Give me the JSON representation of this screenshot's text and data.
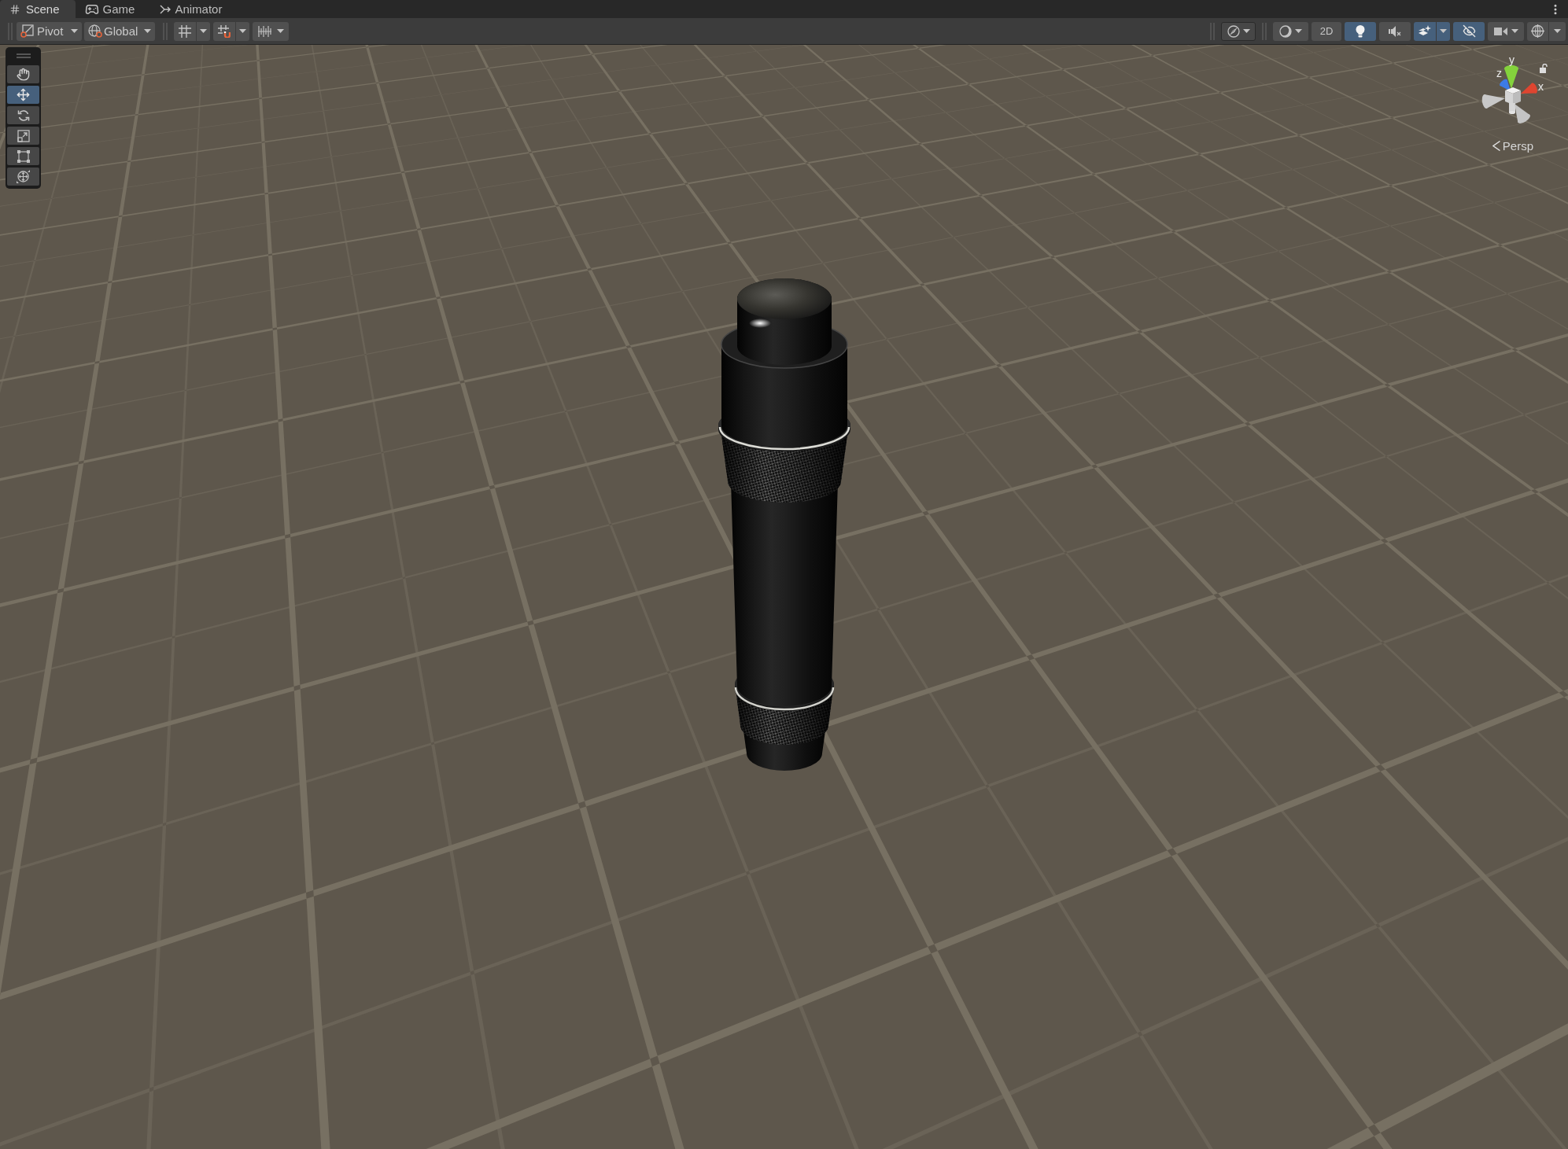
{
  "tabs": [
    {
      "label": "Scene",
      "selected": true
    },
    {
      "label": "Game",
      "selected": false
    },
    {
      "label": "Animator",
      "selected": false
    }
  ],
  "toolbar": {
    "pivot_dropdown": {
      "label": "Pivot"
    },
    "global_dropdown": {
      "label": "Global"
    },
    "view_2d": {
      "label": "2D",
      "on": false
    },
    "lighting": {
      "on": true
    },
    "audio": {
      "on": false
    },
    "effects": {
      "on": true
    },
    "hidden_objects": {
      "on": true
    }
  },
  "tools": [
    {
      "selected": false
    },
    {
      "selected": true
    },
    {
      "selected": false
    },
    {
      "selected": false
    },
    {
      "selected": false
    },
    {
      "selected": false
    }
  ],
  "orientation_gizmo": {
    "axes": [
      {
        "label": "y",
        "color": "#84d23c"
      },
      {
        "label": "z",
        "color": "#3d7be6"
      },
      {
        "label": "x",
        "color": "#de4530"
      }
    ],
    "projection": "Persp"
  }
}
